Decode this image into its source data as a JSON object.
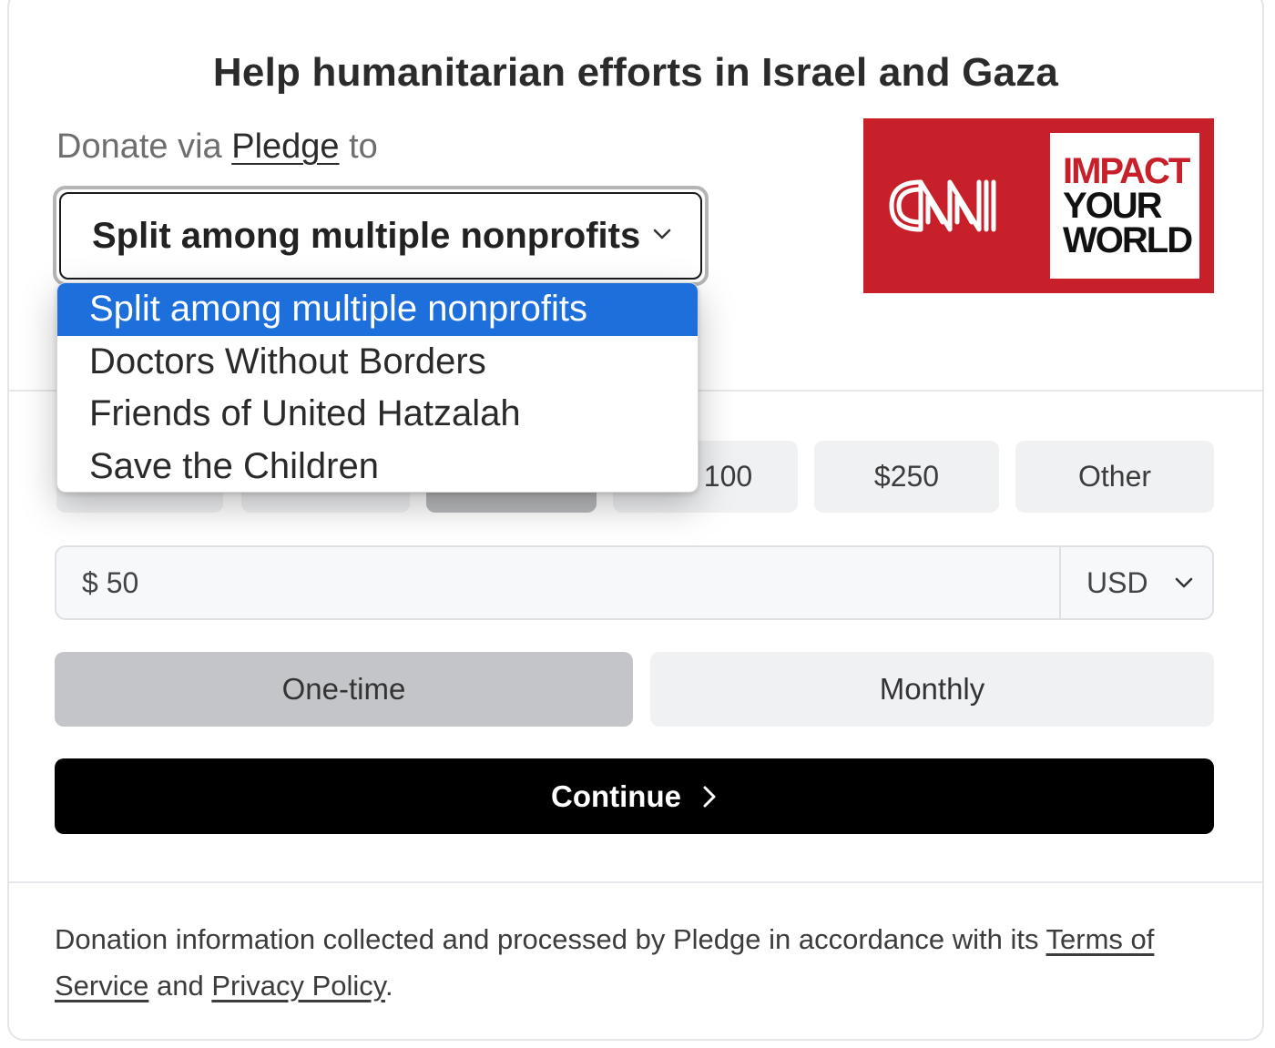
{
  "title": "Help humanitarian efforts in Israel and Gaza",
  "donate": {
    "prefix": "Donate via",
    "link": "Pledge",
    "suffix": "to"
  },
  "nonprofit_select": {
    "value": "Split among multiple nonprofits",
    "options": [
      "Split among multiple nonprofits",
      "Doctors Without Borders",
      "Friends of United Hatzalah",
      "Save the Children"
    ],
    "highlighted_index": 0
  },
  "logo": {
    "brand": "CNN",
    "lines": [
      "IMPACT",
      "YOUR",
      "WORLD"
    ],
    "brand_color": "#c8202a"
  },
  "amounts": {
    "visible_labels": [
      "100",
      "$250",
      "Other"
    ]
  },
  "amount_field": {
    "value": "$ 50",
    "currency": "USD"
  },
  "frequency": {
    "one_time": "One-time",
    "monthly": "Monthly",
    "selected": "One-time"
  },
  "continue_label": "Continue",
  "footer": {
    "text": "Donation information collected and processed by Pledge in accordance with its",
    "terms_link": "Terms of Service",
    "and": "and",
    "privacy_link": "Privacy Policy",
    "end": "."
  },
  "colors": {
    "accent_highlight": "#1d6fdc",
    "button_primary": "#000000",
    "selected_tile": "#b9babd"
  }
}
